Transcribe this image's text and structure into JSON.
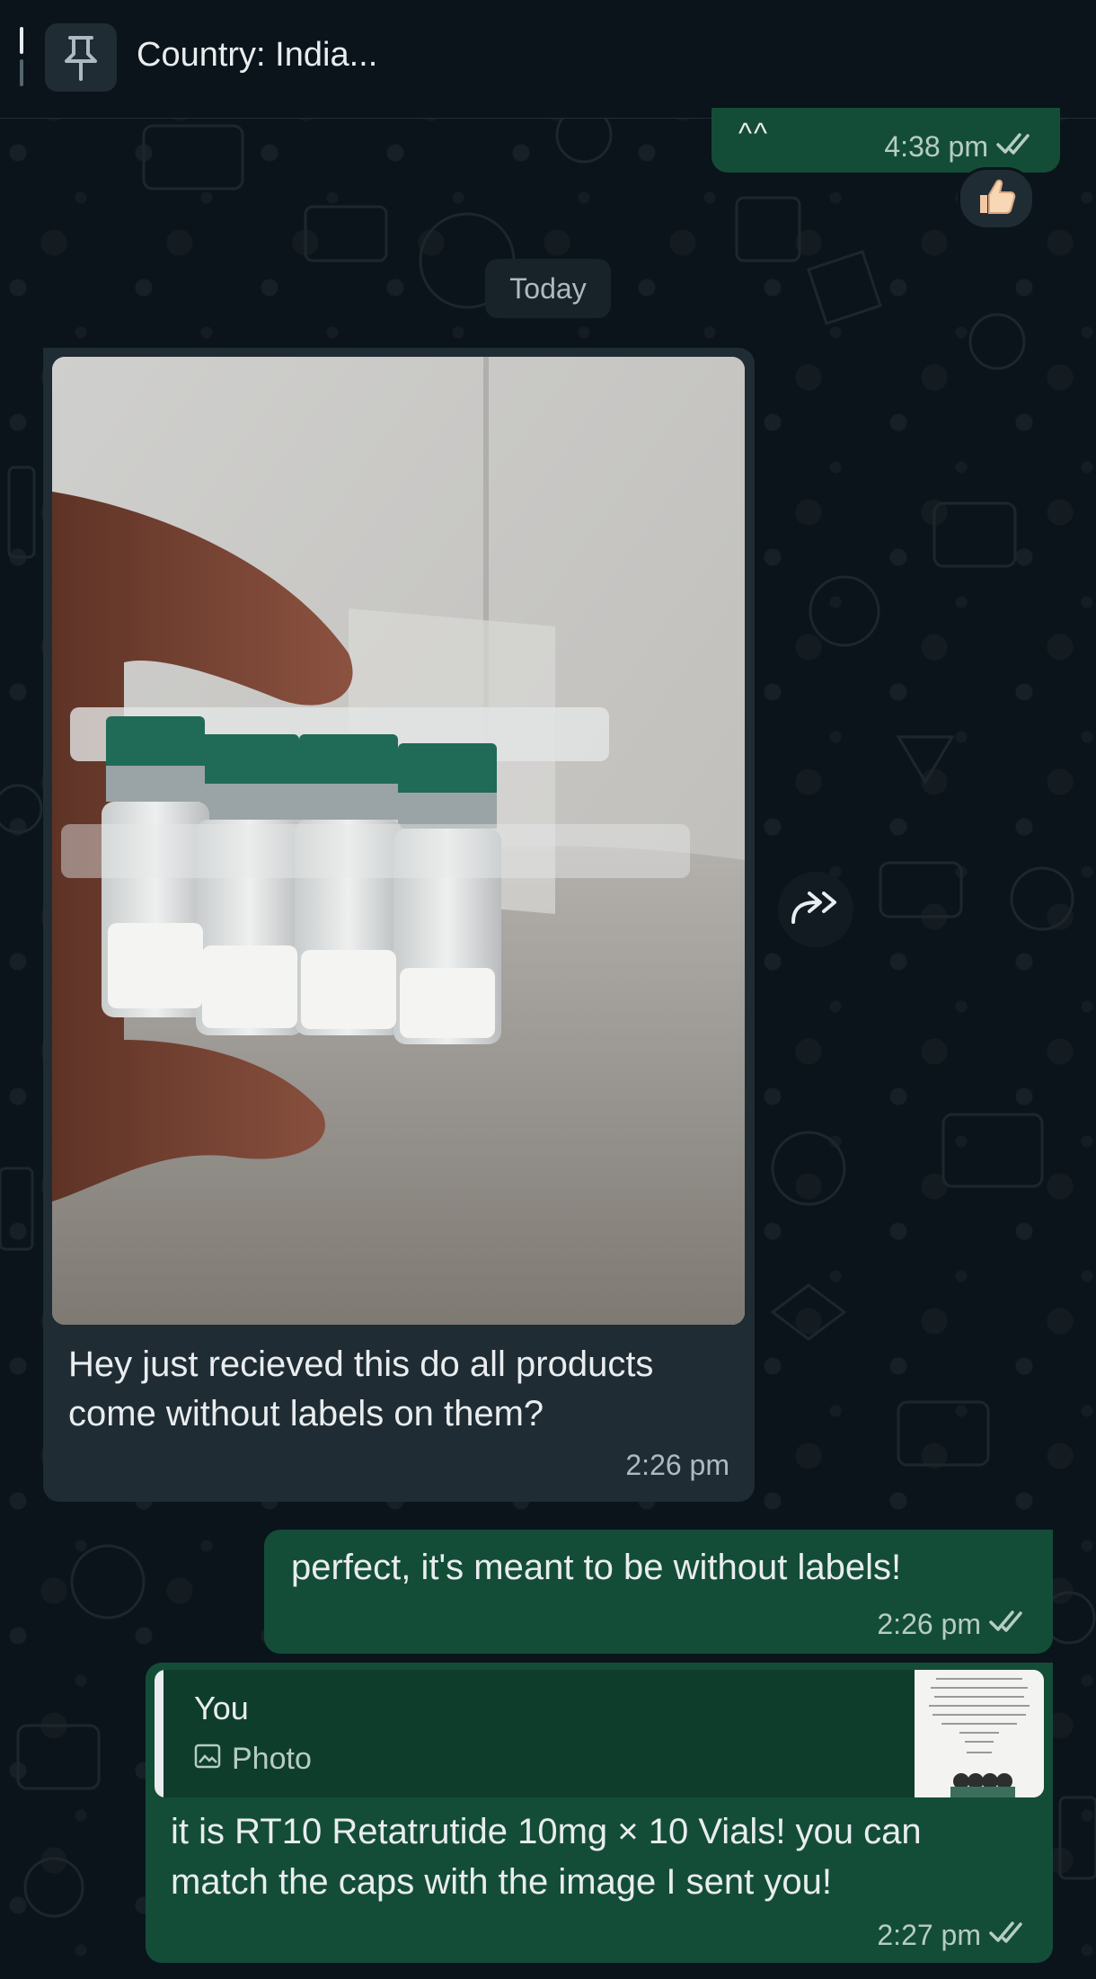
{
  "pinned": {
    "text": "Country: India..."
  },
  "messages": {
    "top_outgoing": {
      "text": "^^",
      "time": "4:38 pm"
    },
    "reaction": "👍🏻",
    "date_separator": "Today",
    "photo_message": {
      "caption": "Hey just recieved this do all products come without labels on them?",
      "time": "2:26 pm"
    },
    "reply_perfect": {
      "text": "perfect, it's meant to be without labels!",
      "time": "2:26 pm"
    },
    "reply_quote": {
      "quoted_author": "You",
      "quoted_kind": "Photo",
      "text": "it is RT10 Retatrutide 10mg × 10 Vials! you can match the caps with the image I sent you!",
      "time": "2:27 pm"
    }
  },
  "icons": {
    "pin": "pin-icon",
    "forward": "forward-icon",
    "read_ticks": "double-check-icon",
    "photo": "image-icon"
  },
  "colors": {
    "background": "#0b141a",
    "outgoing_bubble": "#144d37",
    "incoming_bubble": "#202c33",
    "read_ticks": "#b6cdc2"
  }
}
